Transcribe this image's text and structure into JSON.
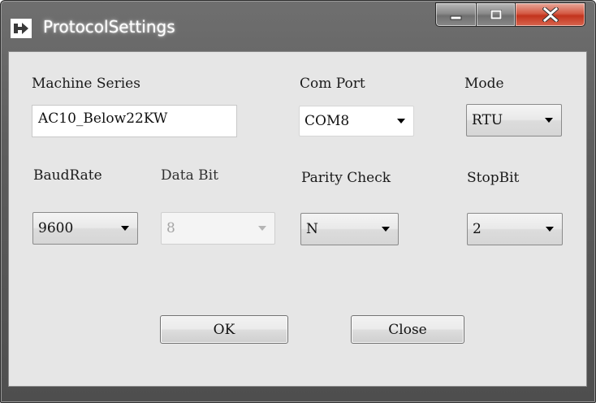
{
  "window": {
    "title": "ProtocolSettings",
    "title_icon": "app-arrow-icon",
    "caption_buttons": [
      "minimize-icon",
      "maximize-icon",
      "close-icon"
    ]
  },
  "form": {
    "machine_series": {
      "label": "Machine Series",
      "value": "AC10_Below22KW"
    },
    "com_port": {
      "label": "Com Port",
      "value": "COM8"
    },
    "mode": {
      "label": "Mode",
      "value": "RTU"
    },
    "baud_rate": {
      "label": "BaudRate",
      "value": "9600"
    },
    "data_bit": {
      "label": "Data Bit",
      "value": "8",
      "disabled": true
    },
    "parity_check": {
      "label": "Parity Check",
      "value": "N"
    },
    "stop_bit": {
      "label": "StopBit",
      "value": "2"
    }
  },
  "buttons": {
    "ok_label": "OK",
    "close_label": "Close"
  },
  "colors": {
    "chrome": "#5c5c5c",
    "client_background": "#e6e6e6",
    "close_button": "#c2341d"
  }
}
